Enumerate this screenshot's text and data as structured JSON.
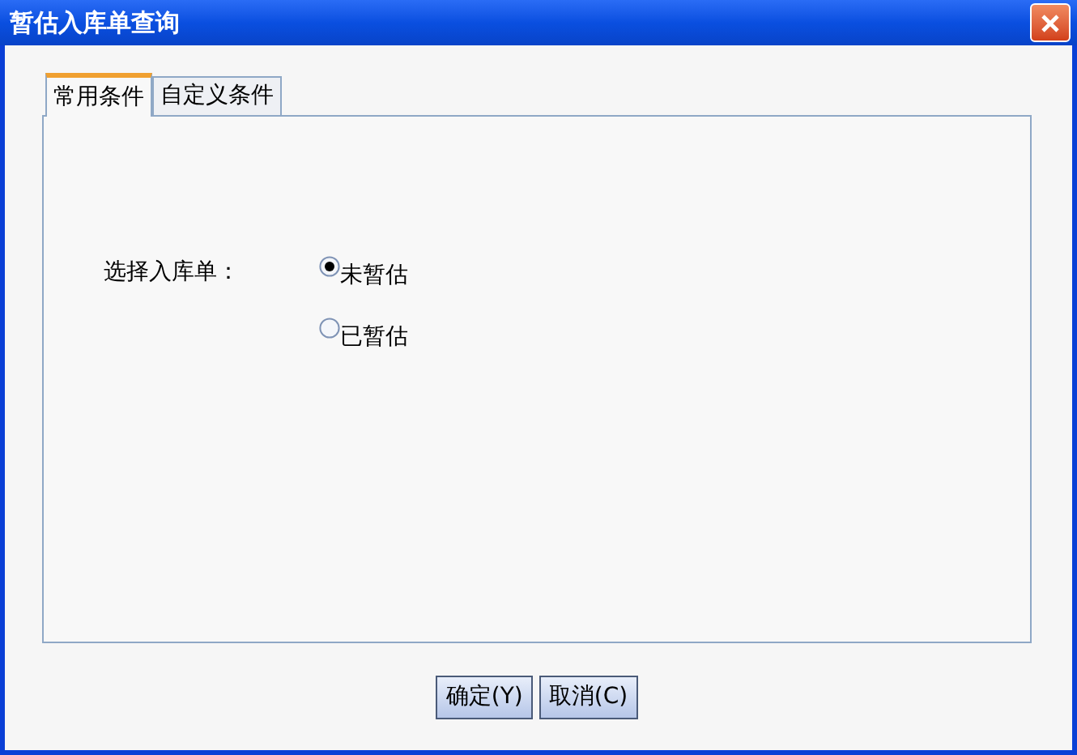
{
  "window": {
    "title": "暂估入库单查询"
  },
  "tabs": [
    {
      "label": "常用条件",
      "selected": true
    },
    {
      "label": "自定义条件",
      "selected": false
    }
  ],
  "form": {
    "label": "选择入库单：",
    "options": [
      {
        "label": "未暂估",
        "selected": true
      },
      {
        "label": "已暂估",
        "selected": false
      }
    ]
  },
  "buttons": [
    "确定(Y)",
    "取消(C)"
  ]
}
